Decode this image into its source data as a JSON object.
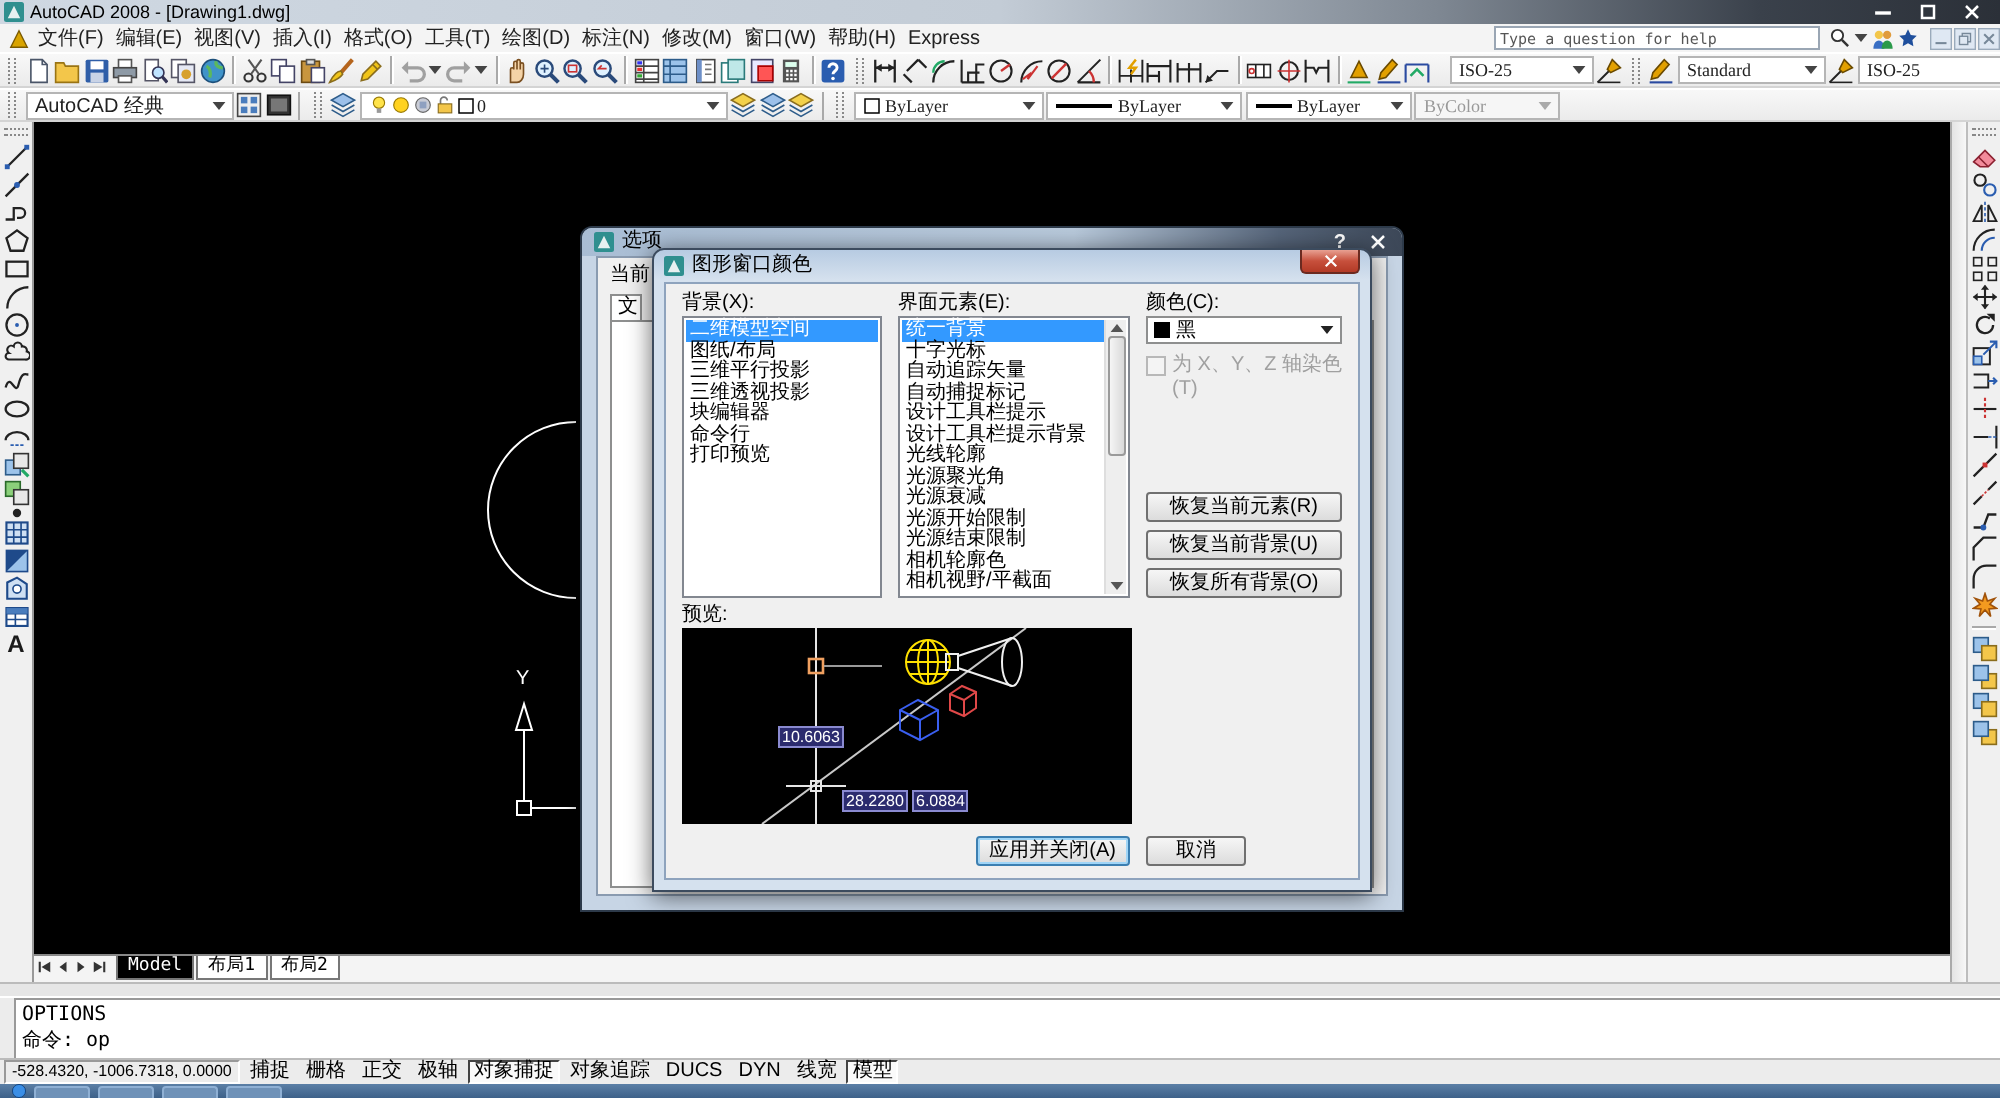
{
  "window": {
    "title": "AutoCAD 2008 - [Drawing1.dwg]"
  },
  "menu_bar": {
    "items": [
      "文件(F)",
      "编辑(E)",
      "视图(V)",
      "插入(I)",
      "格式(O)",
      "工具(T)",
      "绘图(D)",
      "标注(N)",
      "修改(M)",
      "窗口(W)",
      "帮助(H)",
      "Express"
    ],
    "help_search": {
      "placeholder": "Type a question for help"
    }
  },
  "dimension_toolbar": {
    "dimension_style": "ISO-25"
  },
  "styles_toolbar": {
    "text_style": "Standard",
    "dimension_style": "ISO-25"
  },
  "properties_toolbar": {
    "workspace": "AutoCAD 经典",
    "layer": "0",
    "color_control": "ByLayer",
    "linetype": "ByLayer",
    "lineweight": "ByLayer",
    "plot_style": {
      "value": "ByColor",
      "disabled": true
    }
  },
  "draw_toolbar": {
    "text_tool_label": "A"
  },
  "canvas": {
    "ucs_label": "Y"
  },
  "layout_tabs": [
    {
      "label": "Model",
      "selected": true
    },
    {
      "label": "布局1",
      "selected": false
    },
    {
      "label": "布局2",
      "selected": false
    }
  ],
  "command_window": {
    "lines": [
      "OPTIONS",
      "命令: op"
    ]
  },
  "status_bar": {
    "coordinates": "-528.4320, -1006.7318, 0.0000",
    "toggles": [
      {
        "label": "捕捉",
        "on": false
      },
      {
        "label": "栅格",
        "on": false
      },
      {
        "label": "正交",
        "on": false
      },
      {
        "label": "极轴",
        "on": false
      },
      {
        "label": "对象捕捉",
        "on": true
      },
      {
        "label": "对象追踪",
        "on": false
      },
      {
        "label": "DUCS",
        "on": false
      },
      {
        "label": "DYN",
        "on": false
      },
      {
        "label": "线宽",
        "on": false
      },
      {
        "label": "模型",
        "on": true
      }
    ]
  },
  "options_dialog": {
    "title": "选项",
    "help_button": "?",
    "profile_label": "当前",
    "tab_label": "文"
  },
  "color_dialog": {
    "title": "图形窗口颜色",
    "context_label": "背景(X):",
    "contexts": [
      {
        "label": "二维模型空间",
        "selected": true
      },
      {
        "label": "图纸/布局",
        "selected": false
      },
      {
        "label": "三维平行投影",
        "selected": false
      },
      {
        "label": "三维透视投影",
        "selected": false
      },
      {
        "label": "块编辑器",
        "selected": false
      },
      {
        "label": "命令行",
        "selected": false
      },
      {
        "label": "打印预览",
        "selected": false
      }
    ],
    "element_label": "界面元素(E):",
    "elements": [
      {
        "label": "统一背景",
        "selected": true
      },
      {
        "label": "十字光标",
        "selected": false
      },
      {
        "label": "自动追踪矢量",
        "selected": false
      },
      {
        "label": "自动捕捉标记",
        "selected": false
      },
      {
        "label": "设计工具栏提示",
        "selected": false
      },
      {
        "label": "设计工具栏提示背景",
        "selected": false
      },
      {
        "label": "光线轮廓",
        "selected": false
      },
      {
        "label": "光源聚光角",
        "selected": false
      },
      {
        "label": "光源衰减",
        "selected": false
      },
      {
        "label": "光源开始限制",
        "selected": false
      },
      {
        "label": "光源结束限制",
        "selected": false
      },
      {
        "label": "相机轮廓色",
        "selected": false
      },
      {
        "label": "相机视野/平截面",
        "selected": false
      }
    ],
    "color_label": "颜色(C):",
    "color_value": "黑",
    "tint_checkbox": {
      "label": "为 X、Y、Z 轴染色(T)",
      "checked": false,
      "disabled": true
    },
    "restore_buttons": [
      "恢复当前元素(R)",
      "恢复当前背景(U)",
      "恢复所有背景(O)"
    ],
    "preview_label": "预览:",
    "preview_dimensions": [
      "10.6063",
      "28.2280",
      "6.0884"
    ],
    "buttons": [
      {
        "label": "应用并关闭(A)",
        "default": true
      },
      {
        "label": "取消",
        "default": false
      }
    ]
  }
}
